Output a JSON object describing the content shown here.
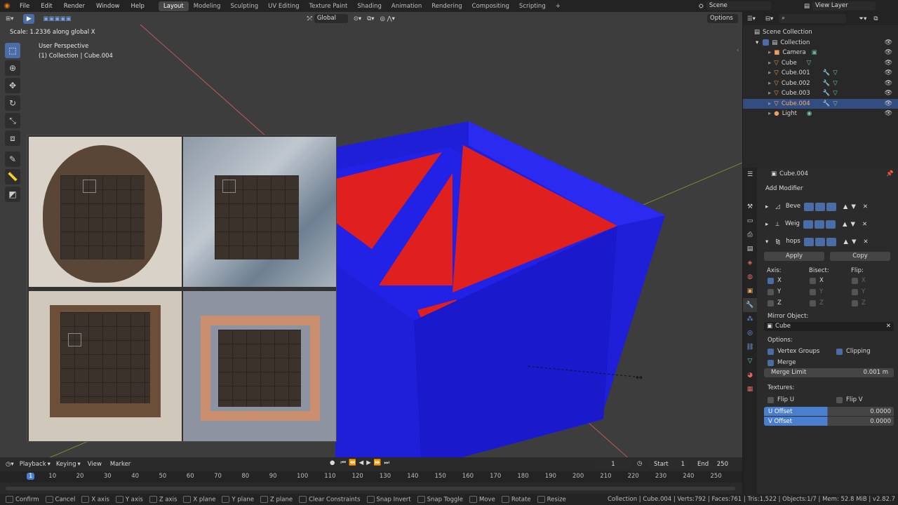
{
  "topbar": {
    "menus": [
      "File",
      "Edit",
      "Render",
      "Window",
      "Help"
    ],
    "workspaces": [
      "Layout",
      "Modeling",
      "Sculpting",
      "UV Editing",
      "Texture Paint",
      "Shading",
      "Animation",
      "Rendering",
      "Compositing",
      "Scripting"
    ],
    "active_workspace": "Layout",
    "scene": "Scene",
    "view_layer": "View Layer"
  },
  "viewport": {
    "operation_hint": "Scale: 1.2336 along global X",
    "perspective": "User Perspective",
    "collection_info": "(1) Collection | Cube.004",
    "orientation": "Global",
    "options": "Options"
  },
  "outliner": {
    "root": "Scene Collection",
    "collection": "Collection",
    "items": [
      {
        "name": "Camera"
      },
      {
        "name": "Cube"
      },
      {
        "name": "Cube.001"
      },
      {
        "name": "Cube.002"
      },
      {
        "name": "Cube.003"
      },
      {
        "name": "Cube.004",
        "selected": true
      },
      {
        "name": "Light"
      }
    ]
  },
  "properties": {
    "object_name": "Cube.004",
    "add_modifier": "Add Modifier",
    "modifiers": [
      "Beve",
      "Weig",
      "hops"
    ],
    "apply": "Apply",
    "copy": "Copy",
    "axis_label": "Axis:",
    "bisect_label": "Bisect:",
    "flip_label": "Flip:",
    "axes": [
      "X",
      "Y",
      "Z"
    ],
    "mirror_object_label": "Mirror Object:",
    "mirror_object": "Cube",
    "options_label": "Options:",
    "vertex_groups": "Vertex Groups",
    "clipping": "Clipping",
    "merge": "Merge",
    "merge_limit_label": "Merge Limit",
    "merge_limit_value": "0.001 m",
    "textures_label": "Textures:",
    "flip_u": "Flip U",
    "flip_v": "Flip V",
    "u_offset_label": "U Offset",
    "u_offset_value": "0.0000",
    "v_offset_label": "V Offset",
    "v_offset_value": "0.0000"
  },
  "timeline": {
    "menus": [
      "Playback",
      "Keying",
      "View",
      "Marker"
    ],
    "current_frame": "1",
    "start_label": "Start",
    "start": "1",
    "end_label": "End",
    "end": "250",
    "ticks": [
      "1",
      "10",
      "20",
      "30",
      "40",
      "50",
      "60",
      "70",
      "80",
      "90",
      "100",
      "110",
      "120",
      "130",
      "140",
      "150",
      "160",
      "170",
      "180",
      "190",
      "200",
      "210",
      "220",
      "230",
      "240",
      "250"
    ]
  },
  "statusbar": {
    "hints": [
      "Confirm",
      "Cancel",
      "X axis",
      "Y axis",
      "Z axis",
      "X plane",
      "Y plane",
      "Z plane",
      "Clear Constraints",
      "Snap Invert",
      "Snap Toggle",
      "Move",
      "Rotate",
      "Resize"
    ],
    "stats": "Collection | Cube.004 | Verts:792 | Faces:761 | Tris:1,522 | Objects:1/7 | Mem: 52.8 MiB | v2.82.7"
  },
  "colors": {
    "accent": "#4a6da8",
    "mesh_blue": "#1f1fd8",
    "mesh_red": "#e01f1f",
    "viewport_bg": "#3d3d3d"
  }
}
